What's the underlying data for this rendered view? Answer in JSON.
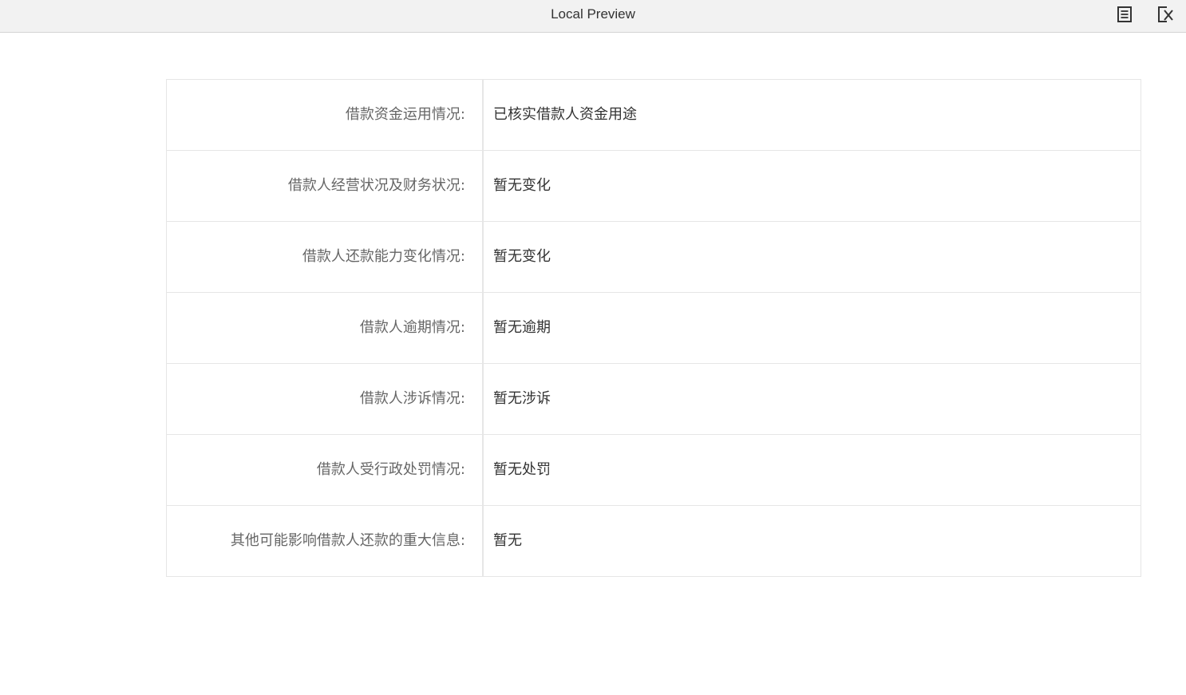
{
  "window": {
    "title": "Local Preview",
    "icons": [
      "list-icon",
      "close-icon"
    ]
  },
  "rows": [
    {
      "label": "借款资金运用情况:",
      "value": "已核实借款人资金用途"
    },
    {
      "label": "借款人经营状况及财务状况:",
      "value": "暂无变化"
    },
    {
      "label": "借款人还款能力变化情况:",
      "value": "暂无变化"
    },
    {
      "label": "借款人逾期情况:",
      "value": "暂无逾期"
    },
    {
      "label": "借款人涉诉情况:",
      "value": "暂无涉诉"
    },
    {
      "label": "借款人受行政处罚情况:",
      "value": "暂无处罚"
    },
    {
      "label": "其他可能影响借款人还款的重大信息:",
      "value": "暂无"
    }
  ]
}
